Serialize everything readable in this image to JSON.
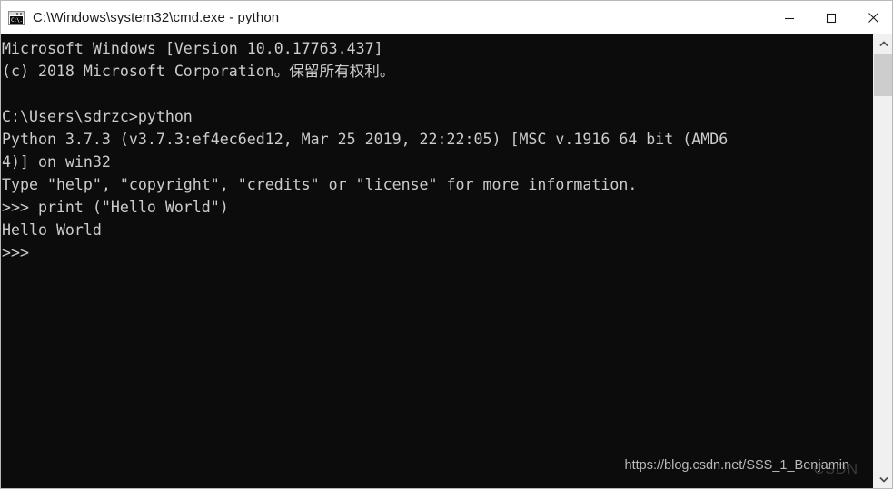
{
  "window": {
    "title": "C:\\Windows\\system32\\cmd.exe - python",
    "icon": "cmd-icon",
    "icon_glyph": "C:\\.",
    "colors": {
      "console_bg": "#0c0c0c",
      "console_fg": "#cccccc",
      "titlebar_bg": "#ffffff",
      "titlebar_fg": "#1c1c1c",
      "scrollbar_track": "#f0f0f0",
      "scrollbar_thumb": "#cdcdcd"
    },
    "controls": {
      "minimize": "minimize-button",
      "maximize": "maximize-button",
      "close": "close-button"
    }
  },
  "console": {
    "lines": [
      "Microsoft Windows [Version 10.0.17763.437]",
      "(c) 2018 Microsoft Corporation。保留所有权利。",
      "",
      "C:\\Users\\sdrzc>python",
      "Python 3.7.3 (v3.7.3:ef4ec6ed12, Mar 25 2019, 22:22:05) [MSC v.1916 64 bit (AMD6",
      "4)] on win32",
      "Type \"help\", \"copyright\", \"credits\" or \"license\" for more information.",
      ">>> print (\"Hello World\")",
      "Hello World",
      ">>>"
    ]
  },
  "watermark": {
    "url": "https://blog.csdn.net/SSS_1_Benjamin",
    "logo": "CSDN"
  },
  "scrollbar": {
    "up_arrow": "chevron-up-icon",
    "down_arrow": "chevron-down-icon"
  }
}
